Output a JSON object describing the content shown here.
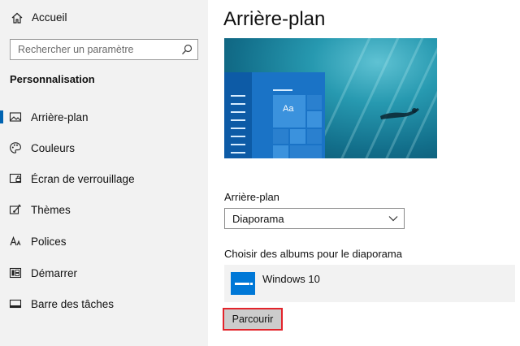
{
  "sidebar": {
    "home_label": "Accueil",
    "search_placeholder": "Rechercher un paramètre",
    "section_title": "Personnalisation",
    "items": [
      {
        "label": "Arrière-plan",
        "icon": "image-icon",
        "active": true
      },
      {
        "label": "Couleurs",
        "icon": "palette-icon"
      },
      {
        "label": "Écran de verrouillage",
        "icon": "lock-screen-icon"
      },
      {
        "label": "Thèmes",
        "icon": "themes-icon"
      },
      {
        "label": "Polices",
        "icon": "fonts-icon"
      },
      {
        "label": "Démarrer",
        "icon": "start-icon"
      },
      {
        "label": "Barre des tâches",
        "icon": "taskbar-icon"
      }
    ]
  },
  "main": {
    "title": "Arrière-plan",
    "preview": {
      "tile_text": "Aa"
    },
    "background_label": "Arrière-plan",
    "background_value": "Diaporama",
    "albums_label": "Choisir des albums pour le diaporama",
    "album_name": "Windows 10",
    "browse_label": "Parcourir"
  },
  "colors": {
    "accent": "#0078d7",
    "highlight_border": "#e3242b",
    "sidebar_bg": "#f2f2f2"
  }
}
